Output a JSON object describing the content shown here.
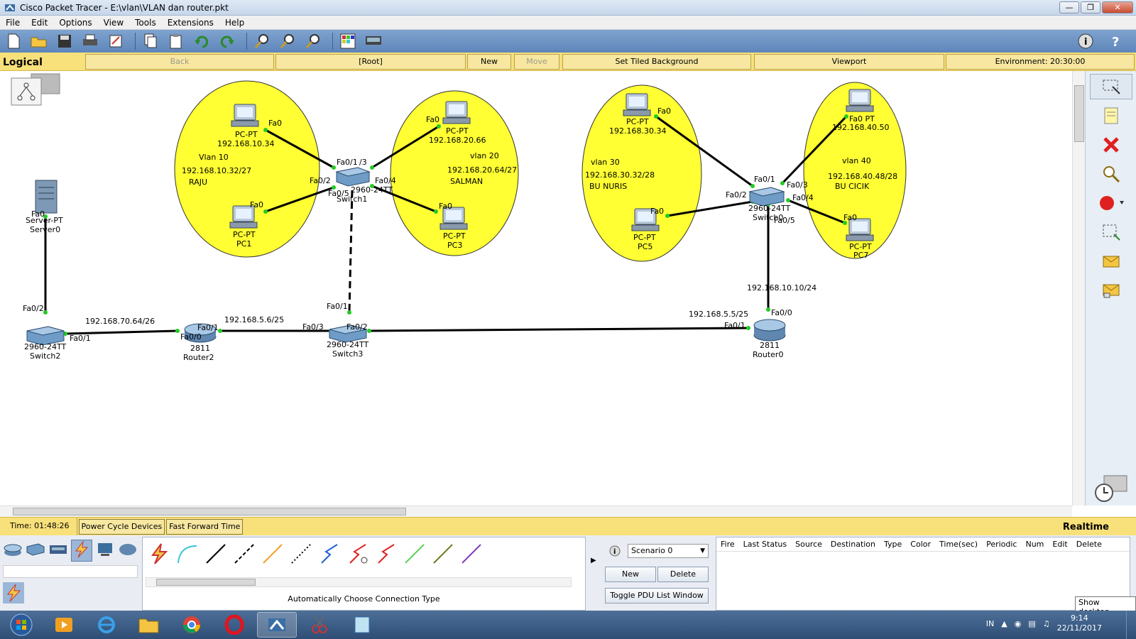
{
  "window": {
    "title": "Cisco Packet Tracer - E:\\vlan\\VLAN dan router.pkt"
  },
  "menu": [
    "File",
    "Edit",
    "Options",
    "View",
    "Tools",
    "Extensions",
    "Help"
  ],
  "navbar": {
    "mode": "Logical",
    "back": "Back",
    "root": "[Root]",
    "new_cluster": "New Cluster",
    "move_object": "Move Object",
    "set_tiled_background": "Set Tiled Background",
    "viewport": "Viewport",
    "environment": "Environment: 20:30:00"
  },
  "vlans": [
    {
      "name": "Vlan 10",
      "subnet": "192.168.10.32/27",
      "owner": "RAJU"
    },
    {
      "name": "vlan 20",
      "subnet": "192.168.20.64/27",
      "owner": "SALMAN"
    },
    {
      "name": "vlan 30",
      "subnet": "192.168.30.32/28",
      "owner": "BU NURIS"
    },
    {
      "name": "vlan 40",
      "subnet": "192.168.40.48/28",
      "owner": "BU CICIK"
    }
  ],
  "devices": {
    "pc0": {
      "type": "PC-PT",
      "ip": "192.168.10.34",
      "port": "Fa0"
    },
    "pc1": {
      "type": "PC-PT",
      "name": "PC1",
      "port": "Fa0"
    },
    "pc2": {
      "type": "PC-PT",
      "ip": "192.168.20.66",
      "port": "Fa0"
    },
    "pc3": {
      "type": "PC-PT",
      "name": "PC3",
      "port": "Fa0"
    },
    "pc4": {
      "type": "PC-PT",
      "ip": "192.168.30.34",
      "port": "Fa0"
    },
    "pc5": {
      "type": "PC-PT",
      "name": "PC5",
      "port": "Fa0"
    },
    "pc6": {
      "type": "Fa0 PT",
      "ip": "192.168.40.50",
      "port": "Fa0"
    },
    "pc7": {
      "type": "PC-PT",
      "name": "PC7",
      "port": "Fa0"
    },
    "server0": {
      "type": "Server-PT",
      "name": "Server0",
      "port": "Fa0"
    },
    "switch1": {
      "model": "2960-24TT",
      "name": "Switch1",
      "ports": [
        "Fa0/1",
        "/3",
        "Fa0/2",
        "Fa0/5",
        "Fa0/4"
      ]
    },
    "switch0": {
      "model": "2960-24TT",
      "name": "Switch0",
      "ports": [
        "Fa0/1",
        "Fa0/3",
        "Fa0/2",
        "Fa0/4",
        "Fa0/5"
      ]
    },
    "switch2": {
      "model": "2960-24TT",
      "name": "Switch2",
      "ports": [
        "Fa0/2",
        "Fa0/1"
      ]
    },
    "switch3": {
      "model": "2960-24TT",
      "name": "Switch3",
      "ports": [
        "Fa0/1",
        "Fa0/3",
        "Fa0/2"
      ]
    },
    "router2": {
      "model": "2811",
      "name": "Router2",
      "ports": [
        "Fa0/1",
        "Fa0/0"
      ]
    },
    "router0": {
      "model": "2811",
      "name": "Router0",
      "ports": [
        "Fa0/0",
        "Fa0/1"
      ]
    }
  },
  "link_labels": {
    "sw2_r2": "192.168.70.64/26",
    "r2_sw3": "192.168.5.6/25",
    "r0_fa01": "192.168.5.5/25",
    "r0_fa00": "192.168.10.10/24"
  },
  "statusbar": {
    "time": "Time: 01:48:26",
    "power_cycle": "Power Cycle Devices",
    "fast_forward": "Fast Forward Time",
    "mode": "Realtime"
  },
  "bottom": {
    "connection_type": "Automatically Choose Connection Type",
    "scenario": "Scenario 0",
    "new": "New",
    "delete": "Delete",
    "toggle_pdu": "Toggle PDU List Window",
    "pdu_columns": [
      "Fire",
      "Last Status",
      "Source",
      "Destination",
      "Type",
      "Color",
      "Time(sec)",
      "Periodic",
      "Num",
      "Edit",
      "Delete"
    ]
  },
  "taskbar": {
    "time": "9:14",
    "date": "22/11/2017",
    "lang": "IN",
    "show_desktop": "Show desktop"
  },
  "colors": {
    "vlan_fill": "#ffff33",
    "link_port": "#22cc22",
    "navbar": "#f8e07a",
    "toolbar": "#6b91c4"
  }
}
